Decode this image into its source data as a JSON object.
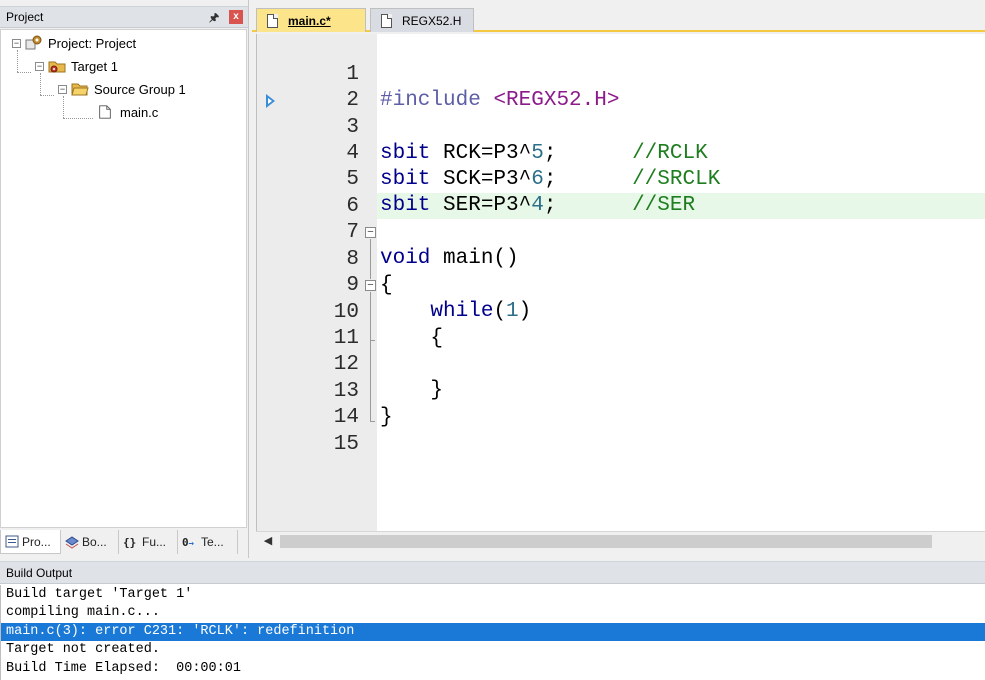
{
  "project_panel": {
    "title": "Project",
    "pin_glyph": "⪯",
    "close_glyph": "x",
    "tree": {
      "project": "Project: Project",
      "target": "Target 1",
      "group": "Source Group 1",
      "file": "main.c"
    },
    "tabs": [
      {
        "label": "Pro...",
        "icon": "project-tab-icon"
      },
      {
        "label": "Bo...",
        "icon": "books-tab-icon"
      },
      {
        "label": "Fu...",
        "icon": "functions-tab-icon"
      },
      {
        "label": "Te...",
        "icon": "templates-tab-icon"
      }
    ]
  },
  "editor": {
    "tabs": [
      {
        "label": "main.c*",
        "active": true
      },
      {
        "label": "REGX52.H",
        "active": false
      }
    ],
    "lines": [
      {
        "n": "1",
        "text": "#include <REGX52.H>"
      },
      {
        "n": "2",
        "text": ""
      },
      {
        "n": "3",
        "text": "sbit RCK=P3^5;      //RCLK"
      },
      {
        "n": "4",
        "text": "sbit SCK=P3^6;      //SRCLK"
      },
      {
        "n": "5",
        "text": "sbit SER=P3^4;      //SER"
      },
      {
        "n": "6",
        "text": ""
      },
      {
        "n": "7",
        "text": "void main()"
      },
      {
        "n": "8",
        "text": "{"
      },
      {
        "n": "9",
        "text": "    while(1)"
      },
      {
        "n": "10",
        "text": "    {"
      },
      {
        "n": "11",
        "text": ""
      },
      {
        "n": "12",
        "text": "    }"
      },
      {
        "n": "13",
        "text": "}"
      },
      {
        "n": "14",
        "text": ""
      },
      {
        "n": "15",
        "text": ""
      }
    ],
    "highlighted_line": "5",
    "current_line": "3"
  },
  "build_output": {
    "title": "Build Output",
    "lines": [
      "Build target 'Target 1'",
      "compiling main.c...",
      "main.c(3): error C231: 'RCLK': redefinition",
      "Target not created.",
      "Build Time Elapsed:  00:00:01"
    ],
    "selected_line": 2
  },
  "colors": {
    "keyword": "#00008b",
    "comment": "#1e7d1e",
    "active_tab": "#fce48a",
    "selection": "#1a78d6",
    "line_highlight": "#e8f8e8"
  }
}
